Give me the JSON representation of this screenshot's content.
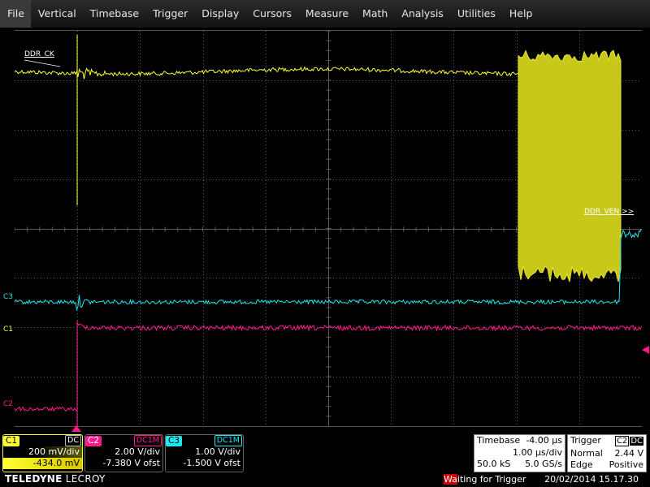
{
  "menu": [
    "File",
    "Vertical",
    "Timebase",
    "Trigger",
    "Display",
    "Cursors",
    "Measure",
    "Math",
    "Analysis",
    "Utilities",
    "Help"
  ],
  "colors": {
    "c1": "#ffff33",
    "c2": "#ff1a8c",
    "c3": "#22e6ee",
    "grid": "#5a5a5a"
  },
  "labels": {
    "ddr_ck": "DDR_CK",
    "ddr_ven": "DDR_VEN >>",
    "c3_marker": "C3",
    "c1_marker": "C1",
    "c2_marker": "C2"
  },
  "channels": [
    {
      "tag": "C1",
      "coupling": "DC",
      "scale": "200 mV/div",
      "offset": "-434.0 mV"
    },
    {
      "tag": "C2",
      "coupling": "DC1M",
      "scale": "2.00 V/div",
      "offset": "-7.380 V ofst"
    },
    {
      "tag": "C3",
      "coupling": "DC1M",
      "scale": "1.00 V/div",
      "offset": "-1.500 V ofst"
    }
  ],
  "timebase": {
    "label": "Timebase",
    "delay": "-4.00 µs",
    "per_div": "1.00 µs/div",
    "samples": "50.0 kS",
    "rate": "5.0 GS/s"
  },
  "trigger": {
    "label": "Trigger",
    "source": "C2",
    "coupling": "DC",
    "mode": "Normal",
    "level": "2.44 V",
    "type": "Edge",
    "slope": "Positive"
  },
  "status": {
    "brand_a": "TELEDYNE",
    "brand_b": " LECROY",
    "message_highlight": "Wa",
    "message_rest": "iting for Trigger",
    "timestamp": "20/02/2014 15.17.30"
  }
}
